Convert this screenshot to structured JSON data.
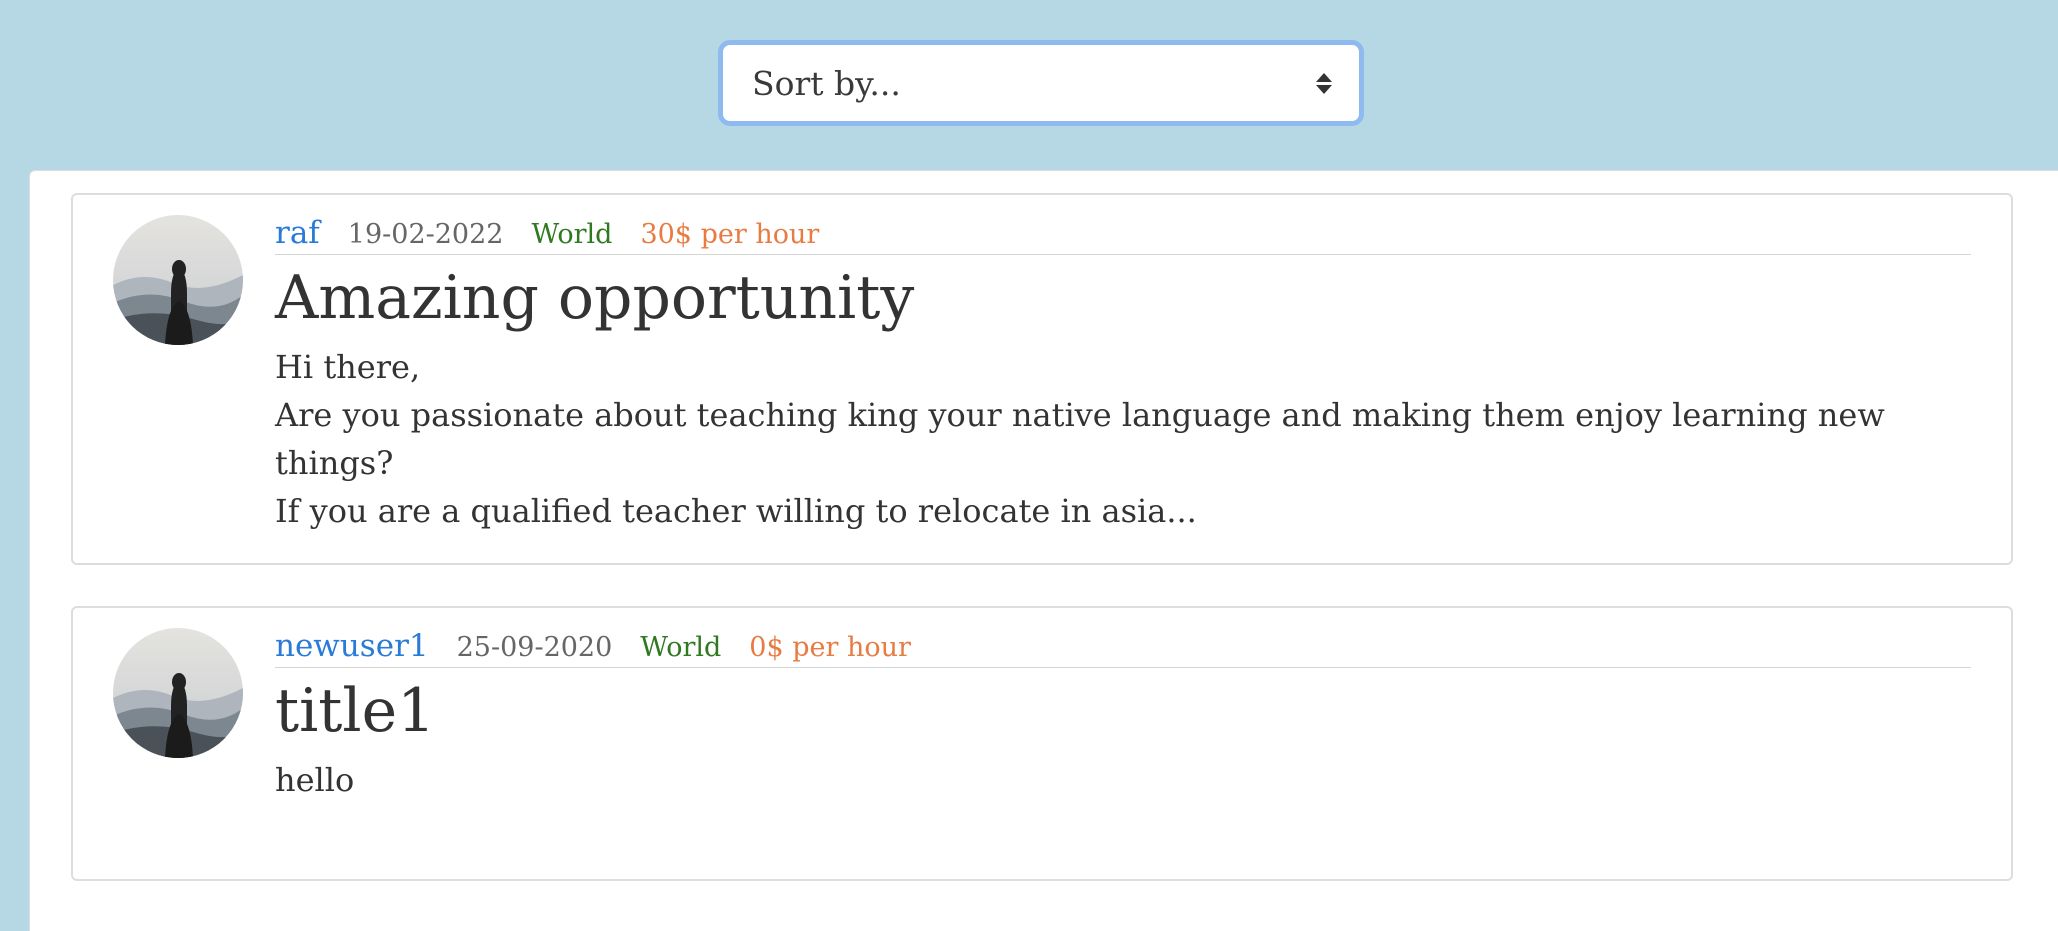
{
  "sort": {
    "placeholder": "Sort by..."
  },
  "posts": [
    {
      "author": "raf",
      "date": "19-02-2022",
      "region": "World",
      "rate": "30$ per hour",
      "title": "Amazing opportunity",
      "lines": [
        "Hi there,",
        "Are you passionate about teaching king your native language and making them enjoy learning new things?",
        "If you are a qualified teacher willing to relocate in asia..."
      ]
    },
    {
      "author": "newuser1",
      "date": "25-09-2020",
      "region": "World",
      "rate": "0$ per hour",
      "title": "title1",
      "lines": [
        "hello"
      ]
    }
  ],
  "colors": {
    "background": "#b5d8e4",
    "author": "#2a7bd9",
    "region": "#2f7a1f",
    "rate": "#e87b42",
    "focus_ring": "#8fbaf0"
  },
  "icons": {
    "sort_arrows": "sort-arrows-icon",
    "avatar": "hooded-figure-mountains-avatar"
  }
}
